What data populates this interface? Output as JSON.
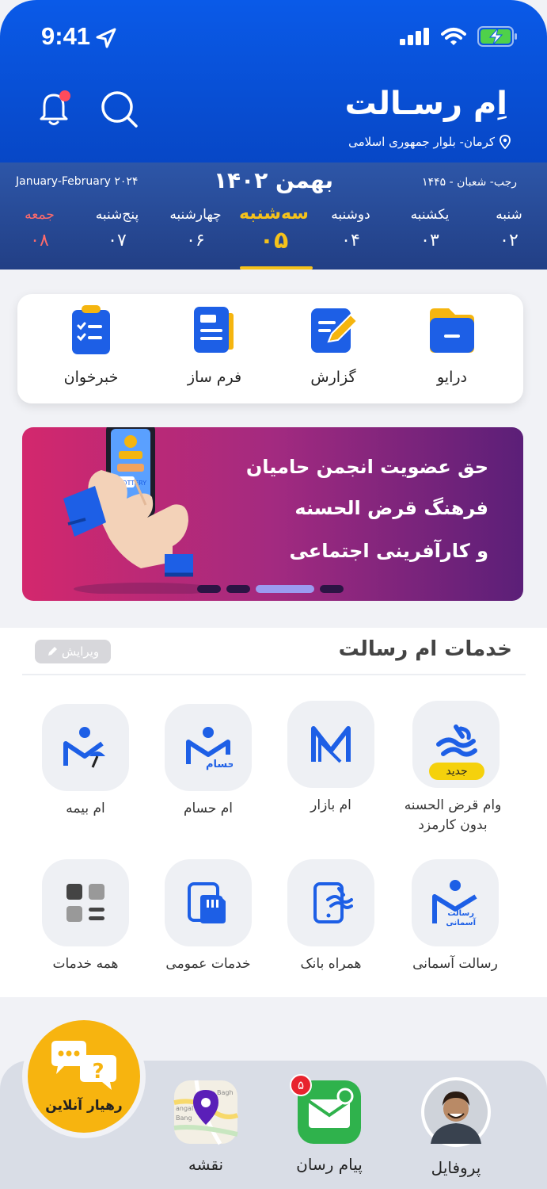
{
  "status_bar": {
    "time": "9:41"
  },
  "header": {
    "app_title": "اِم رسـالت",
    "location": "کرمان- بلوار جمهوری اسلامی"
  },
  "calendar": {
    "gregorian": "January-February ۲۰۲۴",
    "month": "بهمن ۱۴۰۲",
    "hijri": "رجب- شعبان - ۱۴۴۵",
    "days": [
      {
        "name": "شنبه",
        "date": "۰۲"
      },
      {
        "name": "یکشنبه",
        "date": "۰۳"
      },
      {
        "name": "دوشنبه",
        "date": "۰۴"
      },
      {
        "name": "سه‌شنبه",
        "date": "۰۵"
      },
      {
        "name": "چهارشنبه",
        "date": "۰۶"
      },
      {
        "name": "پنج‌شنبه",
        "date": "۰۷"
      },
      {
        "name": "جمعه",
        "date": "۰۸"
      }
    ],
    "today_index": 3
  },
  "quick_actions": [
    {
      "label": "درایو",
      "icon": "folder-icon"
    },
    {
      "label": "گزارش",
      "icon": "report-edit-icon"
    },
    {
      "label": "فرم ساز",
      "icon": "form-builder-icon"
    },
    {
      "label": "خبرخوان",
      "icon": "news-reader-icon"
    }
  ],
  "banner": {
    "lines": [
      "حق عضویت  انجمن حامیان",
      "فرهنگ قرض الحسنه",
      "و کارآفرینی اجتماعی"
    ],
    "phone_caption": "LOTTERY",
    "active_slide": 1
  },
  "services": {
    "title": "خدمات ام رسالت",
    "edit_label": "ویرایش",
    "new_badge": "جدید",
    "items": [
      {
        "label": "وام قرض الحسنه بدون کارمزد",
        "icon": "resalat-loan-icon"
      },
      {
        "label": "ام بازار",
        "icon": "m-bazaar-icon"
      },
      {
        "label": "ام حسام",
        "icon": "m-hesam-icon"
      },
      {
        "label": "ام بیمه",
        "icon": "m-bimeh-icon"
      },
      {
        "label": "رسالت آسمانی",
        "icon": "resalat-asemani-icon"
      },
      {
        "label": "همراه بانک",
        "icon": "mobile-bank-icon"
      },
      {
        "label": "خدمات عمومی",
        "icon": "sim-card-icon"
      },
      {
        "label": "همه خدمات",
        "icon": "all-services-grid-icon"
      }
    ],
    "tile_texts": {
      "hesam": "حسام",
      "asemani_1": "رسالت",
      "asemani_2": "آسمانی"
    }
  },
  "bottom_nav": {
    "helper_label": "رهیار آنلاین",
    "map_label": "نقشه",
    "messenger_label": "پیام رسان",
    "messenger_badge": "۵",
    "profile_label": "پروفایل",
    "map_texts": {
      "top": "Bagh",
      "mid": "angal",
      "bottom": "Bang"
    }
  },
  "colors": {
    "header_blue": "#0a5ae8",
    "calendar_blue": "#2d56a8",
    "today_yellow": "#f5c21b",
    "friday_red": "#ff6b6b",
    "brand_blue": "#1d5fe6",
    "helper_yellow": "#f7b40f",
    "badge_red": "#e8232e",
    "messenger_green": "#2fb24c"
  }
}
